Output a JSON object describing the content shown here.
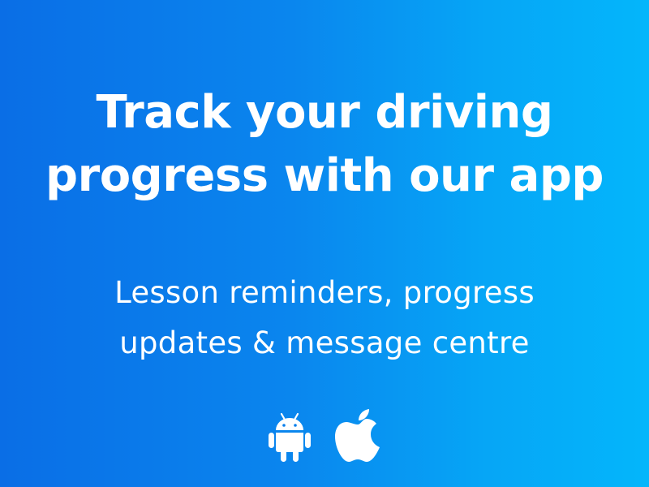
{
  "headline": {
    "line1": "Track your driving",
    "line2": "progress with our app"
  },
  "subheadline": {
    "line1": "Lesson reminders, progress",
    "line2": "updates & message centre"
  },
  "store_icons": [
    {
      "icon": "android-icon"
    },
    {
      "icon": "apple-icon"
    }
  ],
  "colors": {
    "gradient_start": "#0a6ee6",
    "gradient_end": "#04b6fb",
    "text": "#ffffff"
  }
}
